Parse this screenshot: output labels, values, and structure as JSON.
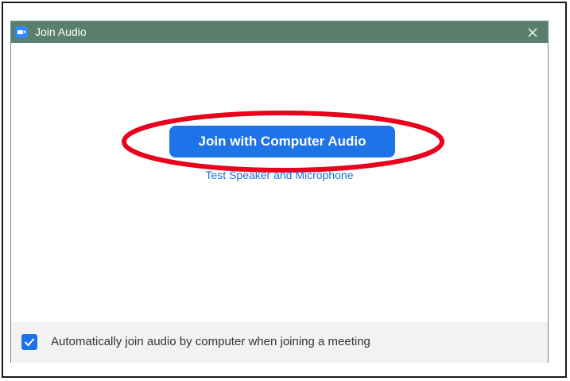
{
  "window": {
    "title": "Join Audio",
    "app_icon": "zoom-camera-icon",
    "close_icon": "close-icon",
    "titlebar_color": "#5b7f6e"
  },
  "main": {
    "join_button_label": "Join with Computer Audio",
    "join_button_color": "#1e73e8",
    "test_link_label": "Test Speaker and Microphone",
    "highlight_color": "#e8001c"
  },
  "footer": {
    "checkbox_checked": true,
    "checkbox_label": "Automatically join audio by computer when joining a meeting"
  }
}
